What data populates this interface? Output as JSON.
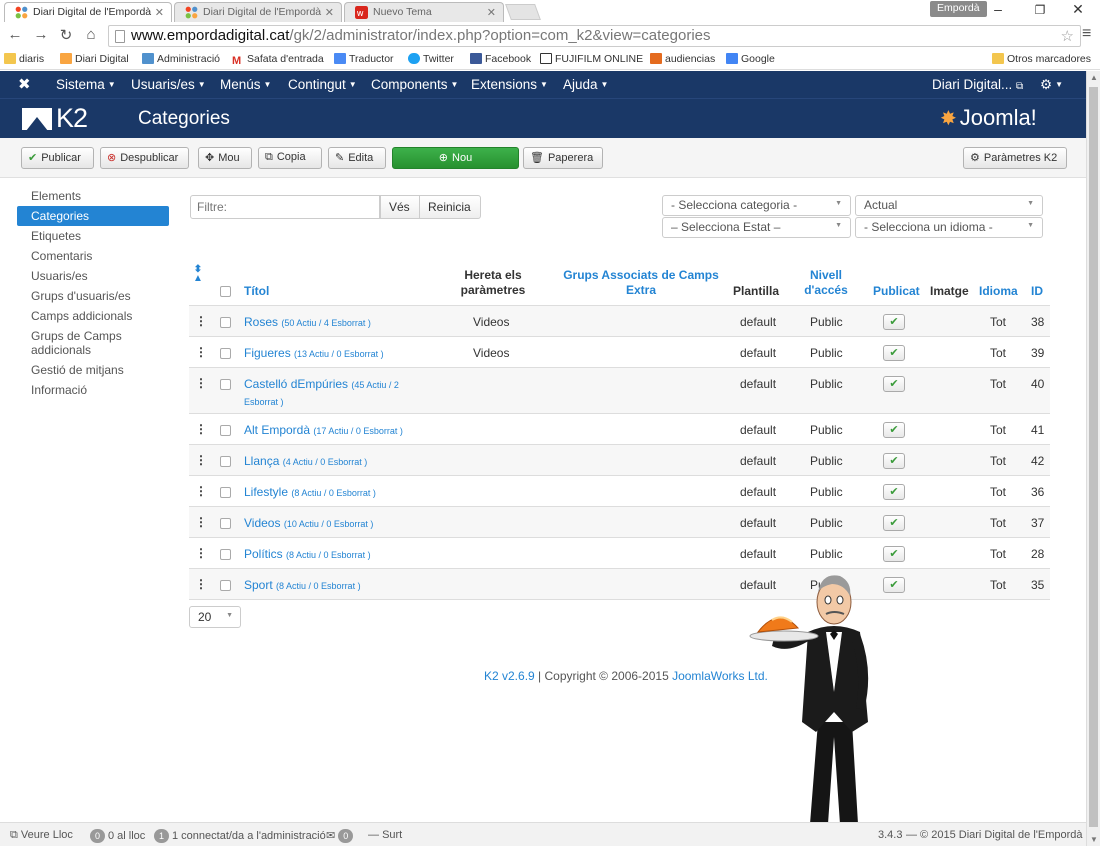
{
  "browser": {
    "tabs": [
      {
        "label": "Diari Digital de l'Empordà",
        "active": true
      },
      {
        "label": "Diari Digital de l'Empordà",
        "active": false
      },
      {
        "label": "Nuevo Tema",
        "active": false
      }
    ],
    "profile": "Empordà",
    "url_host": "www.empordadigital.cat",
    "url_path": "/gk/2/administrator/index.php?option=com_k2&view=categories",
    "bookmarks": [
      "diaris",
      "Diari Digital",
      "Administració",
      "Safata d'entrada",
      "Traductor",
      "Twitter",
      "Facebook",
      "FUJIFILM ONLINE",
      "audiencias",
      "Google"
    ],
    "other_bookmarks": "Otros marcadores"
  },
  "topnav": {
    "items": [
      "Sistema",
      "Usuaris/es",
      "Menús",
      "Contingut",
      "Components",
      "Extensions",
      "Ajuda"
    ],
    "site": "Diari Digital..."
  },
  "header": {
    "logo": "K2",
    "title": "Categories",
    "brand": "Joomla!"
  },
  "toolbar": {
    "publish": "Publicar",
    "unpublish": "Despublicar",
    "move": "Mou",
    "copy": "Copia",
    "edit": "Edita",
    "new": "Nou",
    "trash": "Paperera",
    "params": "Paràmetres K2"
  },
  "sidebar": {
    "items": [
      "Elements",
      "Categories",
      "Etiquetes",
      "Comentaris",
      "Usuaris/es",
      "Grups d'usuaris/es",
      "Camps addicionals",
      "Grups de Camps addicionals",
      "Gestió de mitjans",
      "Informació"
    ],
    "active_index": 1
  },
  "filters": {
    "search_placeholder": "Filtre:",
    "search_button": "Vés",
    "reset_button": "Reinicia",
    "category_select": "- Selecciona categoria -",
    "state_select": "– Selecciona Estat –",
    "current_select": "Actual",
    "language_select": "- Selecciona un idioma -"
  },
  "table": {
    "headers": {
      "title": "Títol",
      "inherit": "Hereta els paràmetres",
      "groups": "Grups Associats de Camps Extra",
      "template": "Plantilla",
      "access": "Nivell d'accés",
      "published": "Publicat",
      "image": "Imatge",
      "language": "Idioma",
      "id": "ID"
    },
    "rows": [
      {
        "title": "Roses",
        "counts": "(50 Actiu / 4 Esborrat )",
        "inherit": "Videos",
        "template": "default",
        "access": "Public",
        "lang": "Tot",
        "id": "38"
      },
      {
        "title": "Figueres",
        "counts": "(13 Actiu / 0 Esborrat )",
        "inherit": "Videos",
        "template": "default",
        "access": "Public",
        "lang": "Tot",
        "id": "39"
      },
      {
        "title": "Castelló dEmpúries",
        "counts": "(45 Actiu / 2 Esborrat )",
        "inherit": "",
        "template": "default",
        "access": "Public",
        "lang": "Tot",
        "id": "40"
      },
      {
        "title": "Alt Empordà",
        "counts": "(17 Actiu / 0 Esborrat )",
        "inherit": "",
        "template": "default",
        "access": "Public",
        "lang": "Tot",
        "id": "41"
      },
      {
        "title": "Llança",
        "counts": "(4 Actiu / 0 Esborrat )",
        "inherit": "",
        "template": "default",
        "access": "Public",
        "lang": "Tot",
        "id": "42"
      },
      {
        "title": "Lifestyle",
        "counts": "(8 Actiu / 0 Esborrat )",
        "inherit": "",
        "template": "default",
        "access": "Public",
        "lang": "Tot",
        "id": "36"
      },
      {
        "title": "Videos",
        "counts": "(10 Actiu / 0 Esborrat )",
        "inherit": "",
        "template": "default",
        "access": "Public",
        "lang": "Tot",
        "id": "37"
      },
      {
        "title": "Polítics",
        "counts": "(8 Actiu / 0 Esborrat )",
        "inherit": "",
        "template": "default",
        "access": "Public",
        "lang": "Tot",
        "id": "28"
      },
      {
        "title": "Sport",
        "counts": "(8 Actiu / 0 Esborrat )",
        "inherit": "",
        "template": "default",
        "access": "Public",
        "lang": "Tot",
        "id": "35"
      }
    ]
  },
  "pagination": {
    "limit": "20"
  },
  "footer": {
    "version": "K2 v2.6.9",
    "copyright": " | Copyright © 2006-2015 ",
    "company": "JoomlaWorks Ltd."
  },
  "statusbar": {
    "view_site": "Veure Lloc",
    "visitors_count": "0",
    "visitors_label": "0 al lloc",
    "admins_count": "1",
    "admins_label": "1 connectat/da a l'administració",
    "messages_count": "0",
    "logout": "Surt",
    "version": "3.4.3",
    "copyright": "— © 2015 Diari Digital de l'Empordà"
  },
  "colors": {
    "nav_bg": "#1a3867",
    "link": "#2384d3",
    "new_button": "#2ea03b"
  }
}
